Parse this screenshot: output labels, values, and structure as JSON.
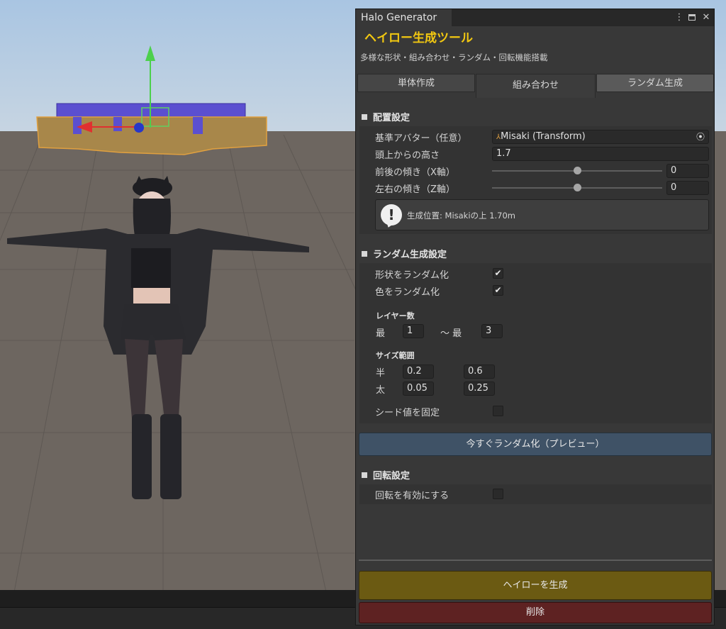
{
  "window": {
    "tab_title": "Halo Generator",
    "header_title": "ヘイロー生成ツール",
    "header_subtitle": "多様な形状・組み合わせ・ランダム・回転機能搭載"
  },
  "tabs": [
    {
      "label": "単体作成",
      "active": false
    },
    {
      "label": "組み合わせ",
      "active": true
    },
    {
      "label": "ランダム生成",
      "active": false
    }
  ],
  "placement": {
    "section_title": "配置設定",
    "avatar_label": "基準アバター（任意）",
    "avatar_value": "Misaki (Transform)",
    "height_label": "頭上からの高さ",
    "height_value": "1.7",
    "tilt_x_label": "前後の傾き（X軸）",
    "tilt_x_value": "0",
    "tilt_z_label": "左右の傾き（Z軸）",
    "tilt_z_value": "0",
    "slider_x_fraction": 0.5,
    "slider_z_fraction": 0.5,
    "help_text": "生成位置: Misakiの上 1.70m"
  },
  "random": {
    "section_title": "ランダム生成設定",
    "shape_label": "形状をランダム化",
    "shape_checked": true,
    "color_label": "色をランダム化",
    "color_checked": true,
    "layers_head": "レイヤー数",
    "layers_min_label": "最",
    "layers_min_value": "1",
    "layers_max_label": "〜 最",
    "layers_max_value": "3",
    "size_head": "サイズ範囲",
    "radius_label": "半",
    "radius_min": "0.2",
    "radius_max": "0.6",
    "thickness_label": "太",
    "thickness_min": "0.05",
    "thickness_max": "0.25",
    "seed_label": "シード値を固定",
    "seed_checked": false,
    "preview_button": "今すぐランダム化（プレビュー）"
  },
  "rotation": {
    "section_title": "回転設定",
    "enable_label": "回転を有効にする",
    "enable_checked": false
  },
  "actions": {
    "generate_button": "ヘイローを生成",
    "delete_button": "削除"
  },
  "colors": {
    "title_accent": "#f2c811",
    "preview_button": "#3f5266",
    "generate_button": "#6b5a12",
    "delete_button": "#5e2222"
  }
}
